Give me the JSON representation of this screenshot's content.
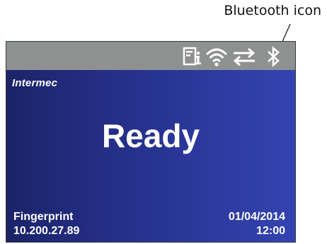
{
  "callout": {
    "label": "Bluetooth icon"
  },
  "status_bar": {
    "icons": [
      "info-icon",
      "wifi-icon",
      "network-transfer-icon",
      "bluetooth-icon"
    ]
  },
  "screen": {
    "brand": "Intermec",
    "status": "Ready",
    "app_name": "Fingerprint",
    "ip_address": "10.200.27.89",
    "date": "01/04/2014",
    "time": "12:00"
  },
  "colors": {
    "status_bar": "#8f9191",
    "screen_gradient_left": "#1b2468",
    "screen_gradient_right": "#3443b2",
    "text": "#ffffff"
  }
}
